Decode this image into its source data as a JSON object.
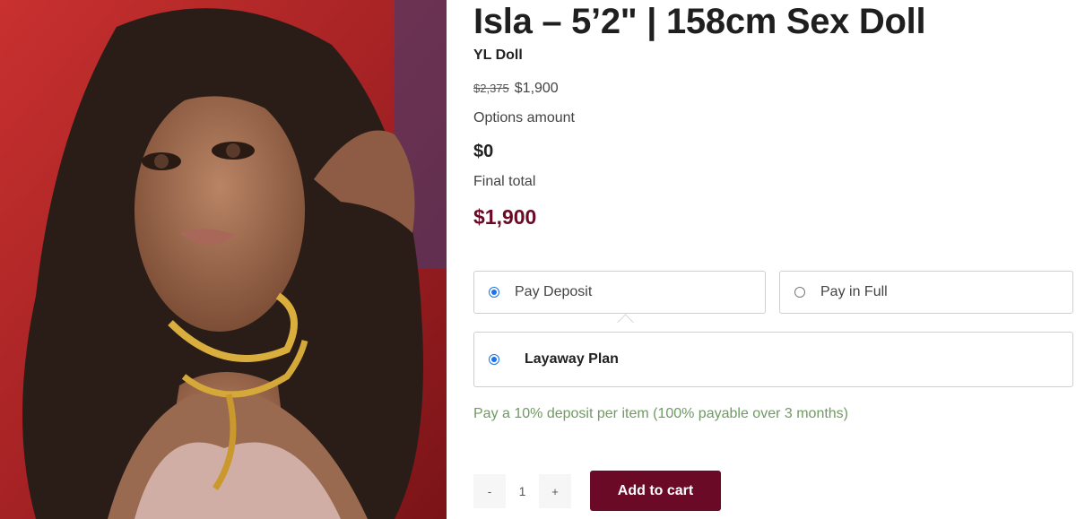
{
  "product": {
    "title": "Isla – 5’2\" | 158cm Sex Doll",
    "brand": "YL Doll",
    "regular_price": "$2,375",
    "sale_price": "$1,900",
    "options_amount_label": "Options amount",
    "options_amount_value": "$0",
    "final_total_label": "Final total",
    "final_total_value": "$1,900"
  },
  "payment": {
    "deposit_label": "Pay Deposit",
    "full_label": "Pay in Full",
    "selected": "deposit",
    "plan_label": "Layaway Plan",
    "plan_description": "Pay a 10% deposit per item (100% payable over 3 months)"
  },
  "cart": {
    "minus_label": "-",
    "quantity": "1",
    "plus_label": "+",
    "add_to_cart_label": "Add to cart"
  },
  "colors": {
    "accent": "#6b0a26",
    "plan_text": "#6f9a63",
    "radio": "#1a73e8",
    "image_background": "#b3272a"
  }
}
